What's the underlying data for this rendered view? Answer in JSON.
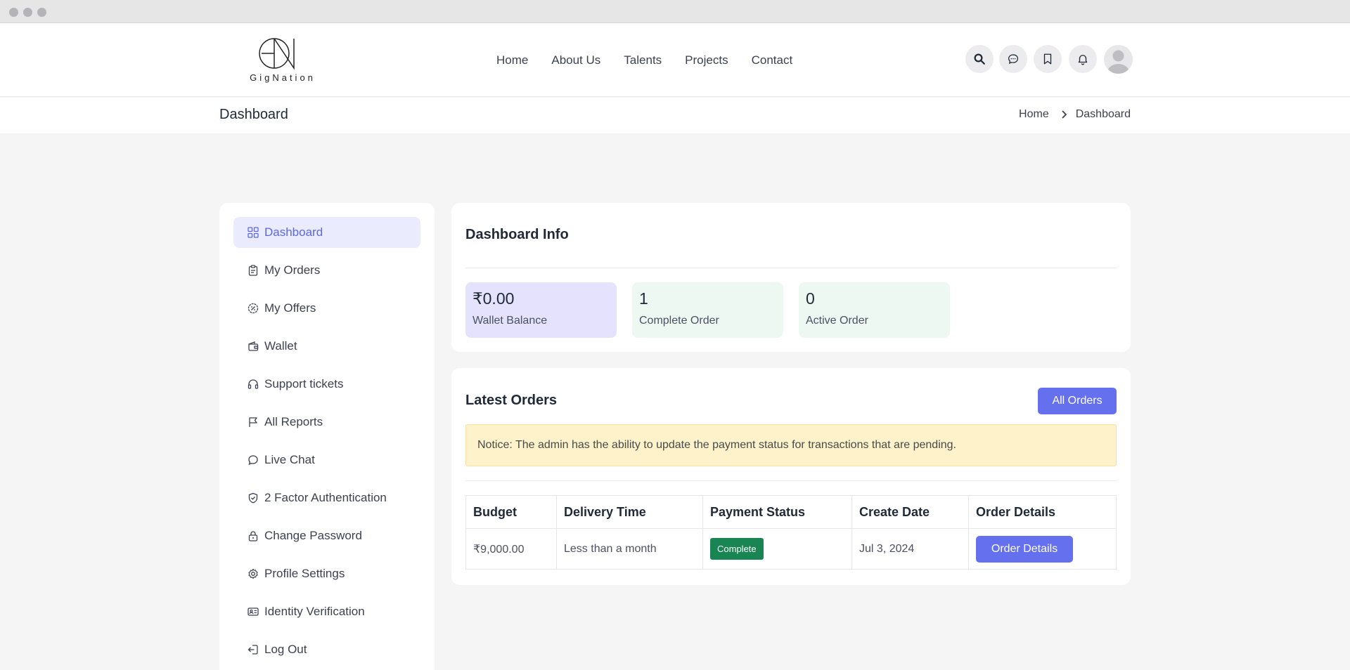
{
  "header": {
    "logo_text": "GigNation",
    "nav": [
      "Home",
      "About Us",
      "Talents",
      "Projects",
      "Contact"
    ]
  },
  "page": {
    "title": "Dashboard",
    "breadcrumb": [
      "Home",
      "Dashboard"
    ]
  },
  "sidebar": {
    "items": [
      {
        "label": "Dashboard",
        "icon": "grid-icon",
        "active": true
      },
      {
        "label": "My Orders",
        "icon": "clipboard-icon"
      },
      {
        "label": "My Offers",
        "icon": "badge-percent-icon"
      },
      {
        "label": "Wallet",
        "icon": "wallet-icon"
      },
      {
        "label": "Support tickets",
        "icon": "headphones-icon"
      },
      {
        "label": "All Reports",
        "icon": "flag-icon"
      },
      {
        "label": "Live Chat",
        "icon": "chat-bubble-icon"
      },
      {
        "label": "2 Factor Authentication",
        "icon": "shield-check-icon"
      },
      {
        "label": "Change Password",
        "icon": "lock-icon"
      },
      {
        "label": "Profile Settings",
        "icon": "gear-icon"
      },
      {
        "label": "Identity Verification",
        "icon": "id-card-icon"
      },
      {
        "label": "Log Out",
        "icon": "logout-icon"
      }
    ]
  },
  "dashboard_info": {
    "title": "Dashboard Info",
    "stats": [
      {
        "value": "₹0.00",
        "label": "Wallet Balance",
        "color": "#e4e2fd"
      },
      {
        "value": "1",
        "label": "Complete Order",
        "color": "#eef8f2"
      },
      {
        "value": "0",
        "label": "Active Order",
        "color": "#eef8f2"
      }
    ]
  },
  "latest_orders": {
    "title": "Latest Orders",
    "all_orders_label": "All Orders",
    "notice": "Notice: The admin has the ability to update the payment status for transactions that are pending.",
    "columns": [
      "Budget",
      "Delivery Time",
      "Payment Status",
      "Create Date",
      "Order Details"
    ],
    "rows": [
      {
        "budget": "₹9,000.00",
        "delivery": "Less than a month",
        "status": "Complete",
        "date": "Jul 3, 2024",
        "action": "Order Details"
      }
    ]
  },
  "colors": {
    "accent": "#6470ee",
    "active_bg": "#eaecfd",
    "success": "#188553",
    "notice_bg": "#fdf2c9"
  }
}
